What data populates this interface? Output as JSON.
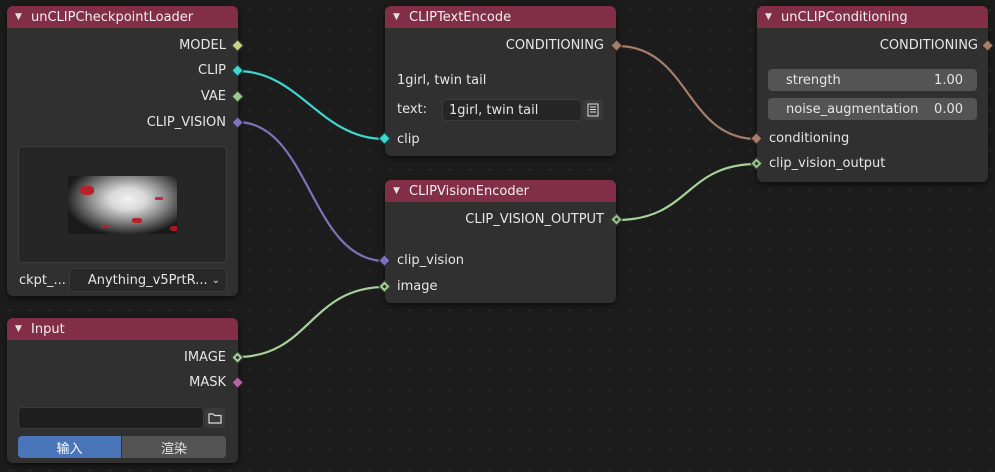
{
  "nodes": {
    "checkpoint_loader": {
      "title": "unCLIPCheckpointLoader",
      "outputs": [
        "MODEL",
        "CLIP",
        "VAE",
        "CLIP_VISION"
      ],
      "ckpt_label": "ckpt_...",
      "ckpt_value": "Anything_v5PrtR..."
    },
    "input": {
      "title": "Input",
      "outputs": [
        "IMAGE",
        "MASK"
      ],
      "path_value": "",
      "tab_active": "输入",
      "tab_inactive": "渲染"
    },
    "clip_text_encode": {
      "title": "CLIPTextEncode",
      "output": "CONDITIONING",
      "preview_text": "1girl, twin tail",
      "text_label": "text:",
      "text_value": "1girl, twin tail",
      "input": "clip"
    },
    "clip_vision_encoder": {
      "title": "CLIPVisionEncoder",
      "output": "CLIP_VISION_OUTPUT",
      "inputs": [
        "clip_vision",
        "image"
      ]
    },
    "unclip_conditioning": {
      "title": "unCLIPConditioning",
      "output": "CONDITIONING",
      "strength_label": "strength",
      "strength_value": "1.00",
      "noise_label": "noise_augmentation",
      "noise_value": "0.00",
      "inputs": [
        "conditioning",
        "clip_vision_output"
      ]
    }
  },
  "colors": {
    "header": "#822e48",
    "node_body": "#303030",
    "canvas": "#1c1c1c",
    "link_clip": "#3fd6d0",
    "link_clip_vision": "#7b74b8",
    "link_conditioning": "#a57e6a",
    "link_image": "#a6d29a",
    "active_tab": "#4a75b8"
  },
  "icons": {
    "collapse": "chevron-down-icon",
    "text_editor": "text-editor-icon",
    "folder": "folder-icon",
    "dropdown": "chevron-down-icon"
  }
}
